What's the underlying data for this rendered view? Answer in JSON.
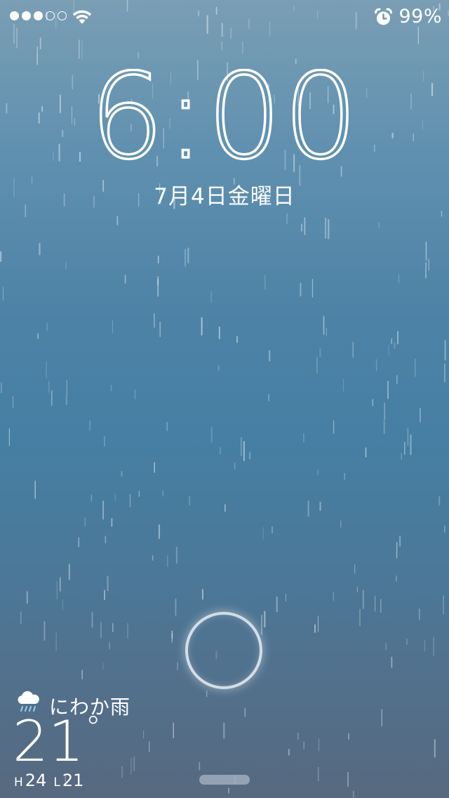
{
  "status_bar": {
    "signal_bars_filled": 3,
    "signal_bars_total": 5,
    "wifi_icon": "wifi-icon",
    "alarm_icon": "alarm-clock-icon",
    "battery_text": "99%"
  },
  "lock_screen": {
    "time": "6:00",
    "date": "7月4日金曜日"
  },
  "weather": {
    "icon": "rain-cloud-icon",
    "condition": "にわか雨",
    "temperature": "21",
    "degree_symbol": "°",
    "high_label": "H",
    "high_value": "24",
    "low_label": "L",
    "low_value": "21"
  },
  "colors": {
    "background_top": "#7a9eb4",
    "background_middle": "#467fa4",
    "background_bottom": "#56697f",
    "text": "#ffffff"
  }
}
